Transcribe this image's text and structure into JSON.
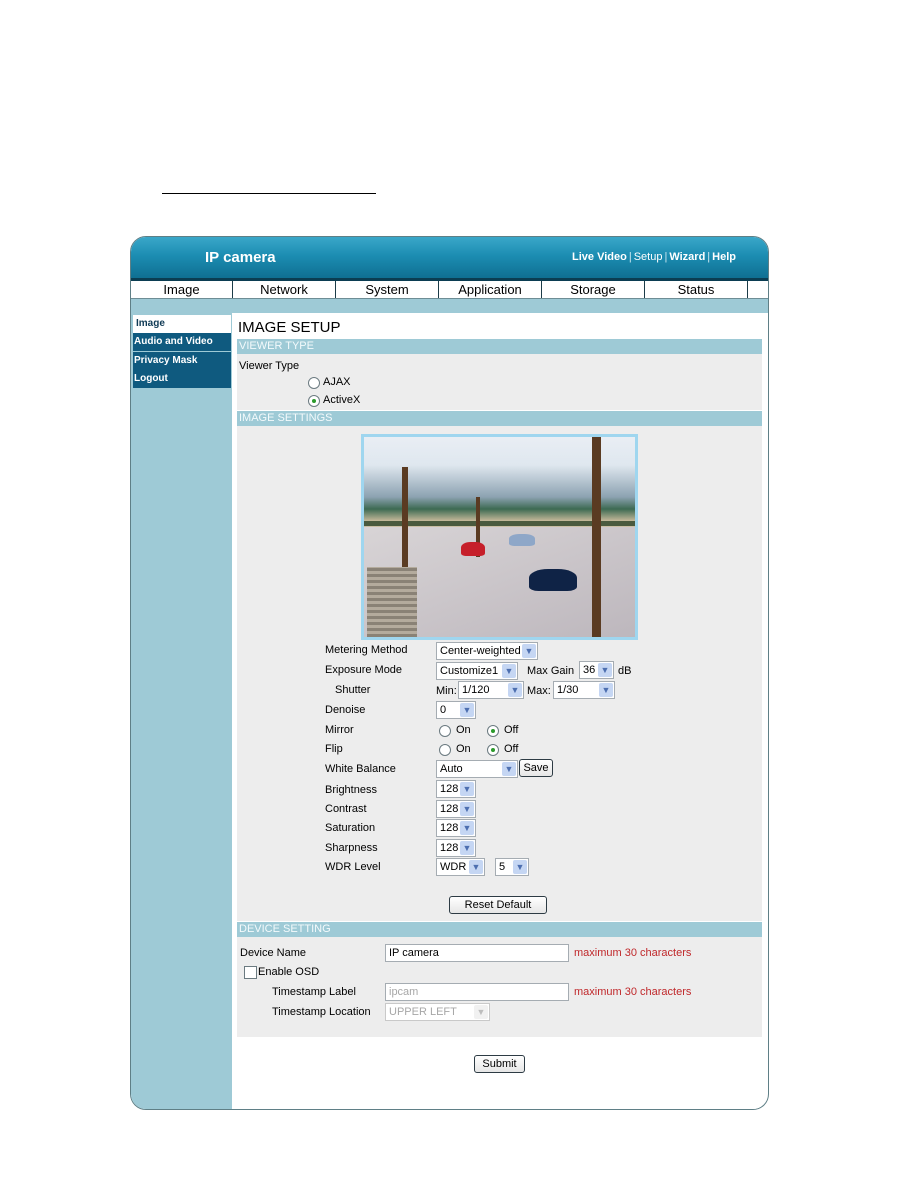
{
  "header": {
    "title": "IP camera",
    "links": [
      {
        "label": "Live Video",
        "bold": true
      },
      {
        "label": "Setup",
        "bold": false
      },
      {
        "label": "Wizard",
        "bold": true
      },
      {
        "label": "Help",
        "bold": true
      }
    ],
    "separator": "|"
  },
  "nav": {
    "tabs": [
      "Image",
      "Network",
      "System",
      "Application",
      "Storage",
      "Status"
    ]
  },
  "sidebar": {
    "items": [
      {
        "label": "Image",
        "active": true
      },
      {
        "label": "Audio and Video",
        "active": false
      },
      {
        "label": "Privacy Mask",
        "active": false
      },
      {
        "label": "Logout",
        "active": false
      }
    ]
  },
  "page": {
    "title": "IMAGE SETUP"
  },
  "viewer": {
    "section_title": "VIEWER TYPE",
    "label": "Viewer Type",
    "options": [
      {
        "label": "AJAX",
        "selected": false
      },
      {
        "label": "ActiveX",
        "selected": true
      }
    ]
  },
  "image_settings": {
    "section_title": "IMAGE SETTINGS",
    "preview_icon": "camera-preview-image",
    "metering_method": {
      "label": "Metering Method",
      "value": "Center-weighted"
    },
    "exposure_mode": {
      "label": "Exposure Mode",
      "value": "Customize1"
    },
    "max_gain": {
      "label": "Max Gain",
      "value": "36",
      "unit": "dB"
    },
    "shutter": {
      "label": "Shutter",
      "min_label": "Min:",
      "min_value": "1/120",
      "max_label": "Max:",
      "max_value": "1/30"
    },
    "denoise": {
      "label": "Denoise",
      "value": "0"
    },
    "mirror": {
      "label": "Mirror",
      "on_label": "On",
      "off_label": "Off",
      "value": "Off"
    },
    "flip": {
      "label": "Flip",
      "on_label": "On",
      "off_label": "Off",
      "value": "Off"
    },
    "white_balance": {
      "label": "White Balance",
      "value": "Auto",
      "save_label": "Save"
    },
    "brightness": {
      "label": "Brightness",
      "value": "128"
    },
    "contrast": {
      "label": "Contrast",
      "value": "128"
    },
    "saturation": {
      "label": "Saturation",
      "value": "128"
    },
    "sharpness": {
      "label": "Sharpness",
      "value": "128"
    },
    "wdr": {
      "label": "WDR Level",
      "mode": "WDR",
      "level": "5"
    },
    "reset_label": "Reset Default"
  },
  "device": {
    "section_title": "DEVICE SETTING",
    "device_name": {
      "label": "Device Name",
      "value": "IP camera",
      "hint": "maximum 30 characters"
    },
    "enable_osd": {
      "label": "Enable OSD",
      "checked": false
    },
    "timestamp_label": {
      "label": "Timestamp Label",
      "value": "ipcam",
      "hint": "maximum 30 characters"
    },
    "timestamp_location": {
      "label": "Timestamp Location",
      "value": "UPPER LEFT"
    }
  },
  "submit_label": "Submit",
  "colors": {
    "header_blue": "#1c8db2",
    "sidebar_dark": "#0f5a7f",
    "section_band": "#9ecad6",
    "hint_red": "#c0282b"
  }
}
